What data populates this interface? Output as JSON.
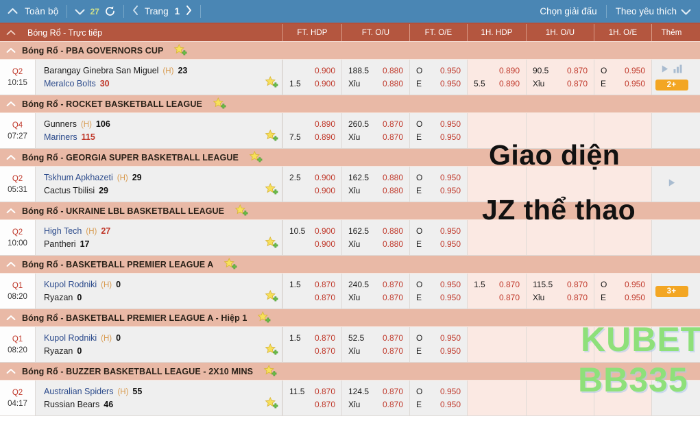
{
  "topbar": {
    "collapse_icon": "chevron-up-icon",
    "all_label": "Toàn bộ",
    "count_chevron_icon": "chevron-down-icon",
    "count": "27",
    "refresh_icon": "refresh-icon",
    "prev_icon": "chevron-left-icon",
    "page_label": "Trang",
    "page_number": "1",
    "next_icon": "chevron-right-icon",
    "select_league_label": "Chọn giải đấu",
    "favorites_label": "Theo yêu thích",
    "favorites_chevron_icon": "chevron-down-icon",
    "bg_color": "#4a86b4"
  },
  "column_header": {
    "collapse_icon": "chevron-up-icon",
    "title": "Bóng Rổ - Trực tiếp",
    "columns": [
      {
        "label": "FT. HDP"
      },
      {
        "label": "FT. O/U"
      },
      {
        "label": "FT. O/E"
      },
      {
        "label": "1H. HDP"
      },
      {
        "label": "1H. O/U"
      },
      {
        "label": "1H. O/E"
      },
      {
        "label": "Thêm"
      }
    ],
    "bg_color": "#b4563f"
  },
  "star_icon_name": "add-favorite-star-icon",
  "groups": [
    {
      "league": "Bóng Rổ - PBA GOVERNORS CUP",
      "match": {
        "period": "Q2",
        "clock": "10:15",
        "home": {
          "name": "Barangay Ginebra San Miguel",
          "h_tag": "(H)",
          "score": "23",
          "is_link": false,
          "score_red": false
        },
        "away": {
          "name": "Meralco Bolts",
          "score": "30",
          "is_link": true,
          "score_red": true
        },
        "ft_hdp": {
          "top_hcp": "",
          "top_val": "0.900",
          "bot_hcp": "1.5",
          "bot_val": "0.900"
        },
        "ft_ou": {
          "top_hcp": "188.5",
          "top_val": "0.880",
          "bot_hcp": "Xỉu",
          "bot_val": "0.880"
        },
        "ft_oe": {
          "top_hcp": "O",
          "top_val": "0.950",
          "bot_hcp": "E",
          "bot_val": "0.950"
        },
        "h1_hdp": {
          "top_hcp": "",
          "top_val": "0.890",
          "bot_hcp": "5.5",
          "bot_val": "0.890"
        },
        "h1_ou": {
          "top_hcp": "90.5",
          "top_val": "0.870",
          "bot_hcp": "Xỉu",
          "bot_val": "0.870"
        },
        "h1_oe": {
          "top_hcp": "O",
          "top_val": "0.950",
          "bot_hcp": "E",
          "bot_val": "0.950"
        },
        "more": {
          "play_icon": "play-icon",
          "stats_icon": "bar-chart-icon",
          "badge": "2+"
        }
      }
    },
    {
      "league": "Bóng Rổ - ROCKET BASKETBALL LEAGUE",
      "match": {
        "period": "Q4",
        "clock": "07:27",
        "home": {
          "name": "Gunners",
          "h_tag": "(H)",
          "score": "106",
          "is_link": false,
          "score_red": false
        },
        "away": {
          "name": "Mariners",
          "score": "115",
          "is_link": true,
          "score_red": true
        },
        "ft_hdp": {
          "top_hcp": "",
          "top_val": "0.890",
          "bot_hcp": "7.5",
          "bot_val": "0.890"
        },
        "ft_ou": {
          "top_hcp": "260.5",
          "top_val": "0.870",
          "bot_hcp": "Xỉu",
          "bot_val": "0.870"
        },
        "ft_oe": {
          "top_hcp": "O",
          "top_val": "0.950",
          "bot_hcp": "E",
          "bot_val": "0.950"
        },
        "h1_hdp": {
          "top_hcp": "",
          "top_val": "",
          "bot_hcp": "",
          "bot_val": ""
        },
        "h1_ou": {
          "top_hcp": "",
          "top_val": "",
          "bot_hcp": "",
          "bot_val": ""
        },
        "h1_oe": {
          "top_hcp": "",
          "top_val": "",
          "bot_hcp": "",
          "bot_val": ""
        },
        "more": {
          "play_icon": "",
          "stats_icon": "",
          "badge": ""
        }
      }
    },
    {
      "league": "Bóng Rổ - GEORGIA SUPER BASKETBALL LEAGUE",
      "match": {
        "period": "Q2",
        "clock": "05:31",
        "home": {
          "name": "Tskhum Apkhazeti",
          "h_tag": "(H)",
          "score": "29",
          "is_link": true,
          "score_red": false
        },
        "away": {
          "name": "Cactus Tbilisi",
          "score": "29",
          "is_link": false,
          "score_red": false
        },
        "ft_hdp": {
          "top_hcp": "2.5",
          "top_val": "0.900",
          "bot_hcp": "",
          "bot_val": "0.900"
        },
        "ft_ou": {
          "top_hcp": "162.5",
          "top_val": "0.880",
          "bot_hcp": "Xỉu",
          "bot_val": "0.880"
        },
        "ft_oe": {
          "top_hcp": "O",
          "top_val": "0.950",
          "bot_hcp": "E",
          "bot_val": "0.950"
        },
        "h1_hdp": {
          "top_hcp": "",
          "top_val": "",
          "bot_hcp": "",
          "bot_val": ""
        },
        "h1_ou": {
          "top_hcp": "",
          "top_val": "",
          "bot_hcp": "",
          "bot_val": ""
        },
        "h1_oe": {
          "top_hcp": "",
          "top_val": "",
          "bot_hcp": "",
          "bot_val": ""
        },
        "more": {
          "play_icon": "play-icon",
          "stats_icon": "",
          "badge": ""
        }
      }
    },
    {
      "league": "Bóng Rổ - UKRAINE LBL BASKETBALL LEAGUE",
      "match": {
        "period": "Q2",
        "clock": "10:00",
        "home": {
          "name": "High Tech",
          "h_tag": "(H)",
          "score": "27",
          "is_link": true,
          "score_red": true
        },
        "away": {
          "name": "Pantheri",
          "score": "17",
          "is_link": false,
          "score_red": false
        },
        "ft_hdp": {
          "top_hcp": "10.5",
          "top_val": "0.900",
          "bot_hcp": "",
          "bot_val": "0.900"
        },
        "ft_ou": {
          "top_hcp": "162.5",
          "top_val": "0.880",
          "bot_hcp": "Xỉu",
          "bot_val": "0.880"
        },
        "ft_oe": {
          "top_hcp": "O",
          "top_val": "0.950",
          "bot_hcp": "E",
          "bot_val": "0.950"
        },
        "h1_hdp": {
          "top_hcp": "",
          "top_val": "",
          "bot_hcp": "",
          "bot_val": ""
        },
        "h1_ou": {
          "top_hcp": "",
          "top_val": "",
          "bot_hcp": "",
          "bot_val": ""
        },
        "h1_oe": {
          "top_hcp": "",
          "top_val": "",
          "bot_hcp": "",
          "bot_val": ""
        },
        "more": {
          "play_icon": "",
          "stats_icon": "",
          "badge": ""
        }
      }
    },
    {
      "league": "Bóng Rổ - BASKETBALL PREMIER LEAGUE A",
      "match": {
        "period": "Q1",
        "clock": "08:20",
        "home": {
          "name": "Kupol Rodniki",
          "h_tag": "(H)",
          "score": "0",
          "is_link": true,
          "score_red": false
        },
        "away": {
          "name": "Ryazan",
          "score": "0",
          "is_link": false,
          "score_red": false
        },
        "ft_hdp": {
          "top_hcp": "1.5",
          "top_val": "0.870",
          "bot_hcp": "",
          "bot_val": "0.870"
        },
        "ft_ou": {
          "top_hcp": "240.5",
          "top_val": "0.870",
          "bot_hcp": "Xỉu",
          "bot_val": "0.870"
        },
        "ft_oe": {
          "top_hcp": "O",
          "top_val": "0.950",
          "bot_hcp": "E",
          "bot_val": "0.950"
        },
        "h1_hdp": {
          "top_hcp": "1.5",
          "top_val": "0.870",
          "bot_hcp": "",
          "bot_val": "0.870"
        },
        "h1_ou": {
          "top_hcp": "115.5",
          "top_val": "0.870",
          "bot_hcp": "Xỉu",
          "bot_val": "0.870"
        },
        "h1_oe": {
          "top_hcp": "O",
          "top_val": "0.950",
          "bot_hcp": "E",
          "bot_val": "0.950"
        },
        "more": {
          "play_icon": "",
          "stats_icon": "",
          "badge": "3+"
        }
      }
    },
    {
      "league": "Bóng Rổ - BASKETBALL PREMIER LEAGUE A - Hiệp 1",
      "match": {
        "period": "Q1",
        "clock": "08:20",
        "home": {
          "name": "Kupol Rodniki",
          "h_tag": "(H)",
          "score": "0",
          "is_link": true,
          "score_red": false
        },
        "away": {
          "name": "Ryazan",
          "score": "0",
          "is_link": false,
          "score_red": false
        },
        "ft_hdp": {
          "top_hcp": "1.5",
          "top_val": "0.870",
          "bot_hcp": "",
          "bot_val": "0.870"
        },
        "ft_ou": {
          "top_hcp": "52.5",
          "top_val": "0.870",
          "bot_hcp": "Xỉu",
          "bot_val": "0.870"
        },
        "ft_oe": {
          "top_hcp": "O",
          "top_val": "0.950",
          "bot_hcp": "E",
          "bot_val": "0.950"
        },
        "h1_hdp": {
          "top_hcp": "",
          "top_val": "",
          "bot_hcp": "",
          "bot_val": ""
        },
        "h1_ou": {
          "top_hcp": "",
          "top_val": "",
          "bot_hcp": "",
          "bot_val": ""
        },
        "h1_oe": {
          "top_hcp": "",
          "top_val": "",
          "bot_hcp": "",
          "bot_val": ""
        },
        "more": {
          "play_icon": "",
          "stats_icon": "",
          "badge": ""
        }
      }
    },
    {
      "league": "Bóng Rổ - BUZZER BASKETBALL LEAGUE - 2X10 MINS",
      "match": {
        "period": "Q2",
        "clock": "04:17",
        "home": {
          "name": "Australian Spiders",
          "h_tag": "(H)",
          "score": "55",
          "is_link": true,
          "score_red": false
        },
        "away": {
          "name": "Russian Bears",
          "score": "46",
          "is_link": false,
          "score_red": false
        },
        "ft_hdp": {
          "top_hcp": "11.5",
          "top_val": "0.870",
          "bot_hcp": "",
          "bot_val": "0.870"
        },
        "ft_ou": {
          "top_hcp": "124.5",
          "top_val": "0.870",
          "bot_hcp": "Xỉu",
          "bot_val": "0.870"
        },
        "ft_oe": {
          "top_hcp": "O",
          "top_val": "0.950",
          "bot_hcp": "E",
          "bot_val": "0.950"
        },
        "h1_hdp": {
          "top_hcp": "",
          "top_val": "",
          "bot_hcp": "",
          "bot_val": ""
        },
        "h1_ou": {
          "top_hcp": "",
          "top_val": "",
          "bot_hcp": "",
          "bot_val": ""
        },
        "h1_oe": {
          "top_hcp": "",
          "top_val": "",
          "bot_hcp": "",
          "bot_val": ""
        },
        "more": {
          "play_icon": "",
          "stats_icon": "",
          "badge": ""
        }
      }
    }
  ],
  "watermarks": {
    "line1": "Giao diện",
    "line2": "JZ thể thao",
    "brand1": "KUBET",
    "brand2": "BB335"
  }
}
